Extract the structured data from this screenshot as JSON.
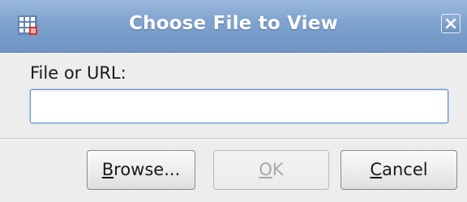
{
  "window": {
    "title": "Choose File to View",
    "app_icon": "grid-app-icon",
    "close_icon": "close-icon"
  },
  "form": {
    "label": "File or URL:",
    "input_value": "",
    "input_placeholder": ""
  },
  "buttons": {
    "browse": {
      "mnemonic": "B",
      "rest": "rowse...",
      "enabled": true
    },
    "ok": {
      "mnemonic": "O",
      "rest": "K",
      "enabled": false
    },
    "cancel": {
      "mnemonic": "C",
      "rest": "ancel",
      "enabled": true
    }
  },
  "colors": {
    "titlebar": "#7ea1cd",
    "dialog_background": "#ededed",
    "input_focus_border": "#6e97c9"
  }
}
